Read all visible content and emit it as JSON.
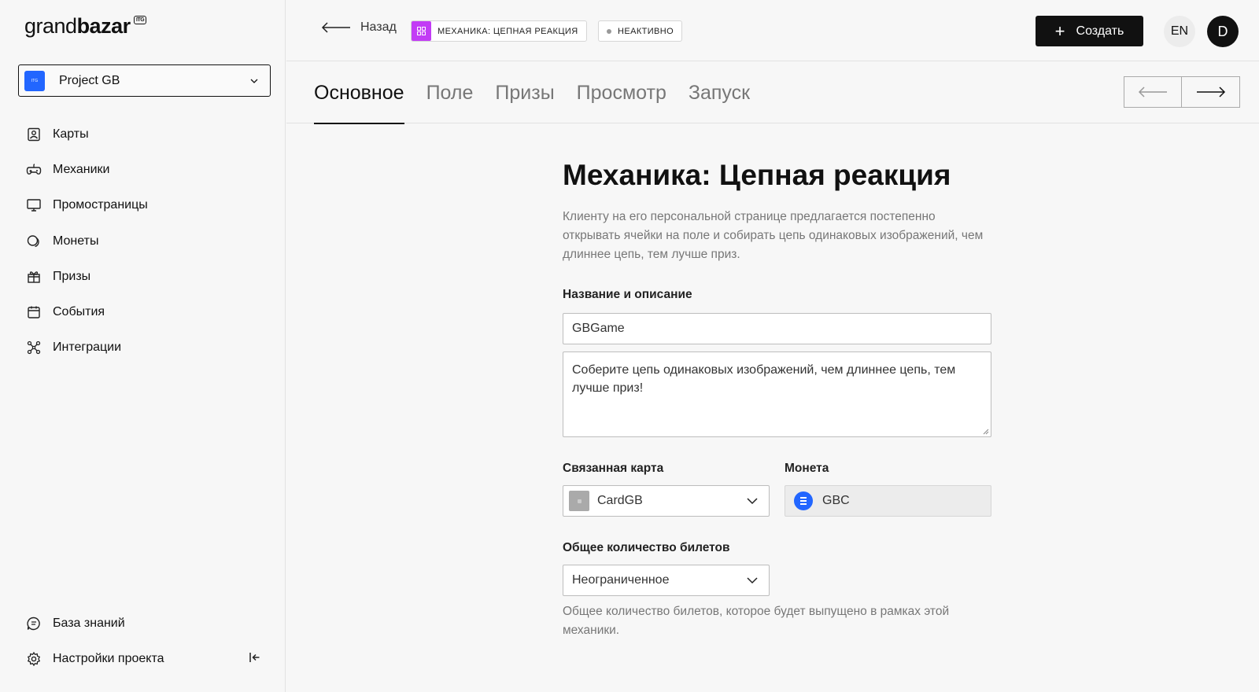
{
  "sidebar": {
    "logo_a": "grand",
    "logo_b": "bazar",
    "logo_tag": "ITG",
    "project": {
      "icon_text": "ITG",
      "name": "Project GB"
    },
    "items": [
      {
        "label": "Карты",
        "icon": "card-icon"
      },
      {
        "label": "Механики",
        "icon": "gamepad-icon"
      },
      {
        "label": "Промостраницы",
        "icon": "monitor-icon"
      },
      {
        "label": "Монеты",
        "icon": "coins-icon"
      },
      {
        "label": "Призы",
        "icon": "gift-icon"
      },
      {
        "label": "События",
        "icon": "calendar-icon"
      },
      {
        "label": "Интеграции",
        "icon": "integrations-icon"
      }
    ],
    "bottom": [
      {
        "label": "База знаний",
        "icon": "knowledge-icon"
      },
      {
        "label": "Настройки проекта",
        "icon": "settings-icon"
      }
    ]
  },
  "topbar": {
    "back_label": "Назад",
    "mechanic_chip": "МЕХАНИКА: ЦЕПНАЯ РЕАКЦИЯ",
    "status_chip": "НЕАКТИВНО",
    "create_label": "Создать",
    "lang": "EN",
    "avatar_initial": "D"
  },
  "tabs": [
    {
      "label": "Основное",
      "active": true
    },
    {
      "label": "Поле",
      "active": false
    },
    {
      "label": "Призы",
      "active": false
    },
    {
      "label": "Просмотр",
      "active": false
    },
    {
      "label": "Запуск",
      "active": false
    }
  ],
  "form": {
    "title": "Механика: Цепная реакция",
    "description": "Клиенту на его персональной странице предлагается постепенно открывать ячейки на поле и собирать цепь одинаковых изображений, чем длиннее цепь, тем лучше приз.",
    "name_section_label": "Название и описание",
    "name_value": "GBGame",
    "description_value": "Соберите цепь одинаковых изображений, чем длиннее цепь, тем лучше приз!",
    "linked_card_label": "Связанная карта",
    "linked_card_value": "CardGB",
    "coin_label": "Монета",
    "coin_value": "GBC",
    "tickets_label": "Общее количество билетов",
    "tickets_value": "Неограниченное",
    "tickets_hint": "Общее количество билетов, которое будет выпущено в рамках этой механики."
  },
  "colors": {
    "mechanic_accent": "#c23cf5",
    "project_accent": "#2266ff",
    "primary_button": "#111111"
  }
}
